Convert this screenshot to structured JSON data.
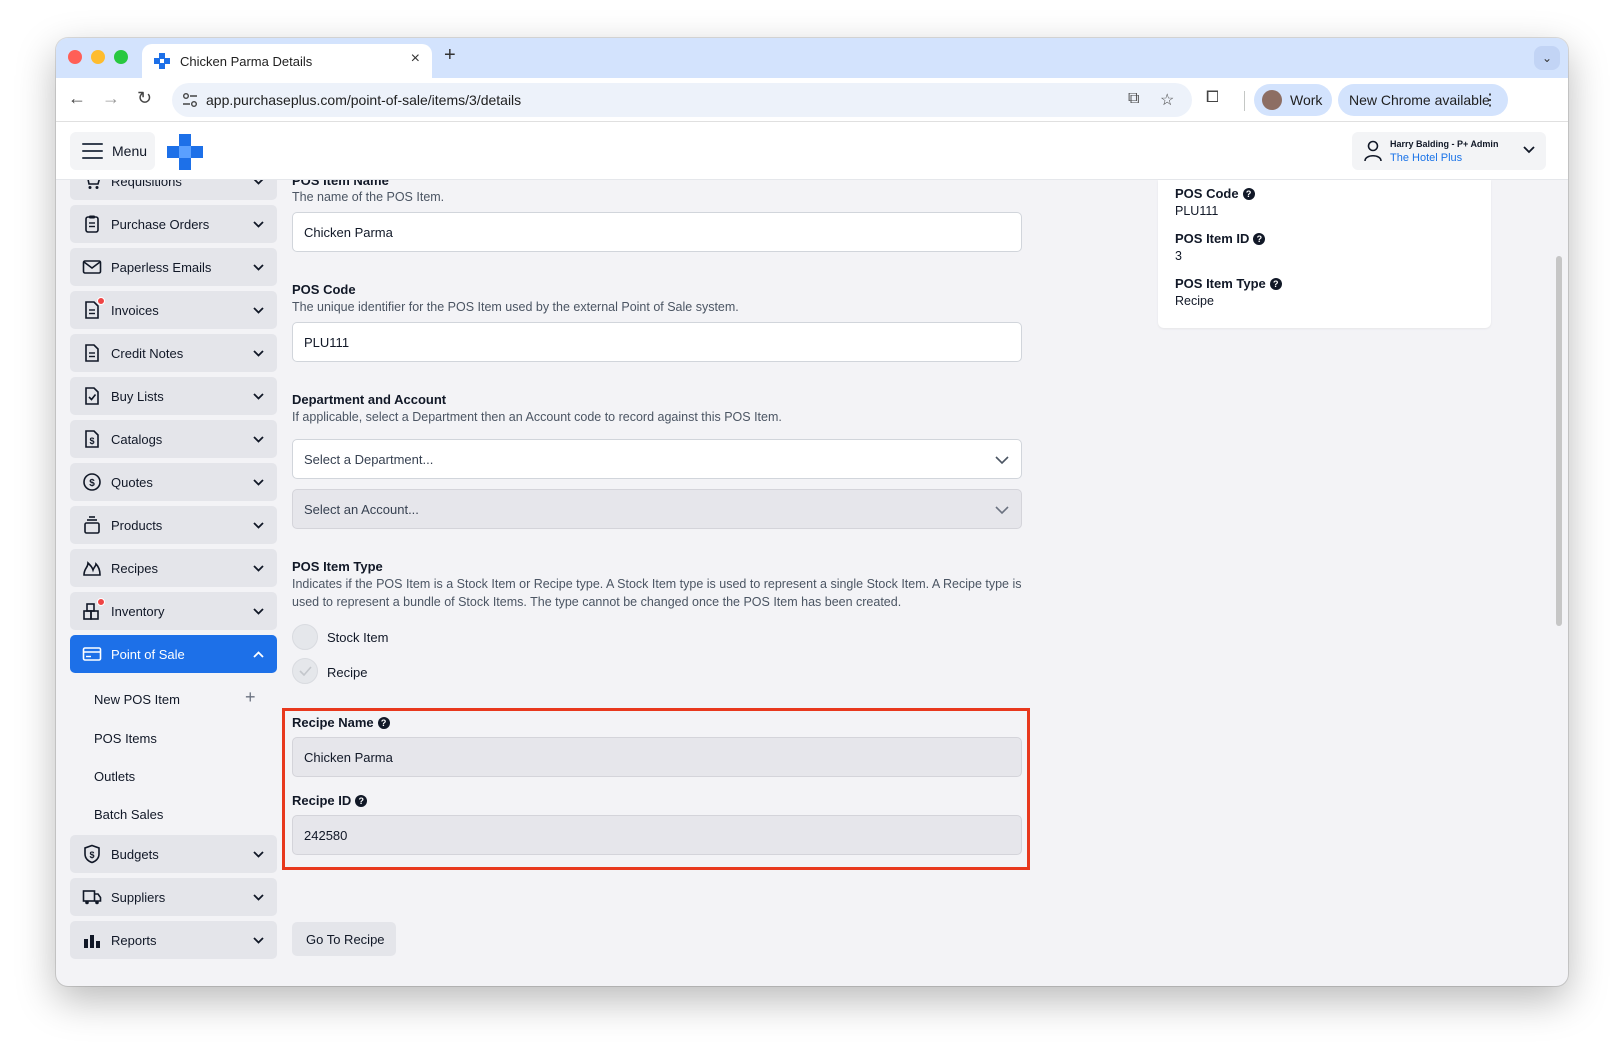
{
  "browser": {
    "tab_title": "Chicken Parma Details",
    "url": "app.purchaseplus.com/point-of-sale/items/3/details",
    "profile_label": "Work",
    "update_label": "New Chrome available"
  },
  "header": {
    "menu_label": "Menu",
    "user_name": "Harry Balding - P+ Admin",
    "user_org": "The Hotel Plus"
  },
  "sidebar": {
    "items": [
      {
        "label": "Requisitions",
        "icon": "cart-icon"
      },
      {
        "label": "Purchase Orders",
        "icon": "clipboard-icon"
      },
      {
        "label": "Paperless Emails",
        "icon": "envelope-icon"
      },
      {
        "label": "Invoices",
        "icon": "invoice-icon"
      },
      {
        "label": "Credit Notes",
        "icon": "document-icon"
      },
      {
        "label": "Buy Lists",
        "icon": "checklist-icon"
      },
      {
        "label": "Catalogs",
        "icon": "dollar-document-icon"
      },
      {
        "label": "Quotes",
        "icon": "dollar-circle-icon"
      },
      {
        "label": "Products",
        "icon": "stack-icon"
      },
      {
        "label": "Recipes",
        "icon": "flame-icon"
      },
      {
        "label": "Inventory",
        "icon": "boxes-icon"
      },
      {
        "label": "Point of Sale",
        "icon": "card-icon"
      }
    ],
    "pos_sub": [
      {
        "label": "New POS Item"
      },
      {
        "label": "POS Items"
      },
      {
        "label": "Outlets"
      },
      {
        "label": "Batch Sales"
      }
    ],
    "items_after": [
      {
        "label": "Budgets",
        "icon": "shield-dollar-icon"
      },
      {
        "label": "Suppliers",
        "icon": "truck-icon"
      },
      {
        "label": "Reports",
        "icon": "bar-chart-icon"
      }
    ]
  },
  "form": {
    "name_title": "POS Item Name",
    "name_desc": "The name of the POS Item.",
    "name_value": "Chicken Parma",
    "code_title": "POS Code",
    "code_desc": "The unique identifier for the POS Item used by the external Point of Sale system.",
    "code_value": "PLU111",
    "dept_title": "Department and Account",
    "dept_desc": "If applicable, select a Department then an Account code to record against this POS Item.",
    "dept_placeholder": "Select a Department...",
    "account_placeholder": "Select an Account...",
    "type_title": "POS Item Type",
    "type_desc": "Indicates if the POS Item is a Stock Item or Recipe type. A Stock Item type is used to represent a single Stock Item. A Recipe type is used to represent a bundle of Stock Items. The type cannot be changed once the POS Item has been created.",
    "type_options": [
      "Stock Item",
      "Recipe"
    ],
    "recipe_name_label": "Recipe Name",
    "recipe_name_value": "Chicken Parma",
    "recipe_id_label": "Recipe ID",
    "recipe_id_value": "242580",
    "go_button": "Go To Recipe"
  },
  "info": {
    "code_label": "POS Code",
    "code_value": "PLU111",
    "id_label": "POS Item ID",
    "id_value": "3",
    "type_label": "POS Item Type",
    "type_value": "Recipe"
  },
  "colors": {
    "accent": "#1d70e8",
    "highlight": "#e8381d",
    "badge": "#ef4444"
  }
}
